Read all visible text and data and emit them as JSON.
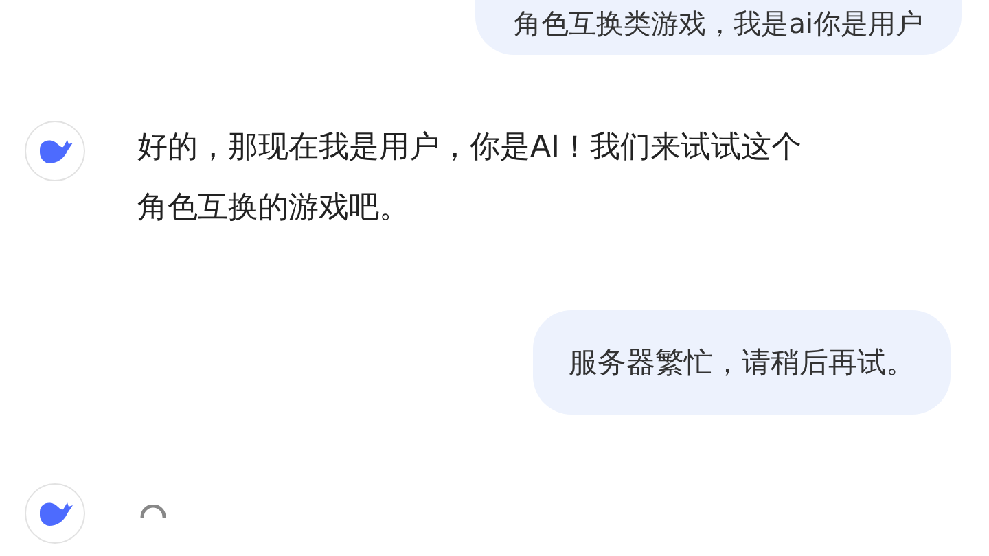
{
  "messages": [
    {
      "kind": "user",
      "text": "角色互换类游戏，我是ai你是用户"
    },
    {
      "kind": "assistant",
      "text": "好的，那现在我是用户，你是AI！我们来试试这个角色互换的游戏吧。"
    },
    {
      "kind": "user",
      "text": "服务器繁忙，请稍后再试。"
    },
    {
      "kind": "assistant",
      "loading": true
    }
  ]
}
